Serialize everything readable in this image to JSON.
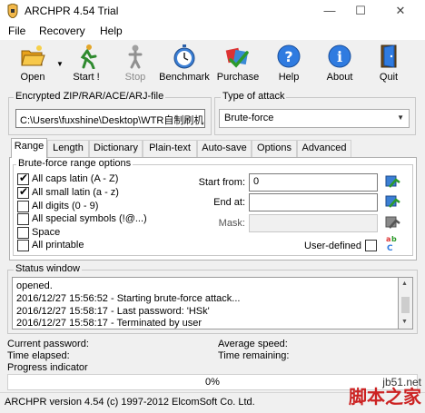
{
  "window": {
    "title": "ARCHPR 4.54 Trial",
    "minimize": "—",
    "maximize": "☐",
    "close": "✕"
  },
  "menu": {
    "items": [
      "File",
      "Recovery",
      "Help"
    ]
  },
  "toolbar": {
    "buttons": [
      {
        "label": "Open",
        "icon": "folder-open-icon"
      },
      {
        "label": "Start !",
        "icon": "runner-icon"
      },
      {
        "label": "Stop",
        "icon": "stop-figure-icon"
      },
      {
        "label": "Benchmark",
        "icon": "stopwatch-icon"
      },
      {
        "label": "Purchase",
        "icon": "purchase-icon"
      },
      {
        "label": "Help",
        "icon": "help-icon"
      },
      {
        "label": "About",
        "icon": "info-icon"
      },
      {
        "label": "Quit",
        "icon": "exit-door-icon"
      }
    ]
  },
  "file_group": {
    "label": "Encrypted ZIP/RAR/ACE/ARJ-file",
    "path": "C:\\Users\\fuxshine\\Desktop\\WTR自制刷机"
  },
  "attack_group": {
    "label": "Type of attack",
    "selected": "Brute-force"
  },
  "tabs": [
    "Range",
    "Length",
    "Dictionary",
    "Plain-text",
    "Auto-save",
    "Options",
    "Advanced"
  ],
  "range": {
    "group_label": "Brute-force range options",
    "options": [
      {
        "label": "All caps latin (A - Z)",
        "checked": true
      },
      {
        "label": "All small latin (a - z)",
        "checked": true
      },
      {
        "label": "All digits (0 - 9)",
        "checked": false
      },
      {
        "label": "All special symbols (!@...)",
        "checked": false
      },
      {
        "label": "Space",
        "checked": false
      },
      {
        "label": "All printable",
        "checked": false
      }
    ],
    "start_from_label": "Start from:",
    "start_from_value": "0",
    "end_at_label": "End at:",
    "end_at_value": "",
    "mask_label": "Mask:",
    "mask_value": "",
    "user_defined_label": "User-defined",
    "user_defined_checked": false
  },
  "status": {
    "label": "Status window",
    "lines": [
      "opened.",
      "2016/12/27 15:56:52 - Starting brute-force attack...",
      "2016/12/27 15:58:17 - Last password: 'HSk'",
      "2016/12/27 15:58:17 - Terminated by user"
    ]
  },
  "info": {
    "current_password": "Current password:",
    "average_speed": "Average speed:",
    "time_elapsed": "Time elapsed:",
    "time_remaining": "Time remaining:",
    "progress_indicator": "Progress indicator",
    "progress_text": "0%",
    "progress_value": 0
  },
  "statusbar": {
    "text": "ARCHPR version 4.54 (c) 1997-2012 ElcomSoft Co. Ltd."
  },
  "watermark": {
    "line1": "jb51.net",
    "line2": "脚本之家"
  }
}
